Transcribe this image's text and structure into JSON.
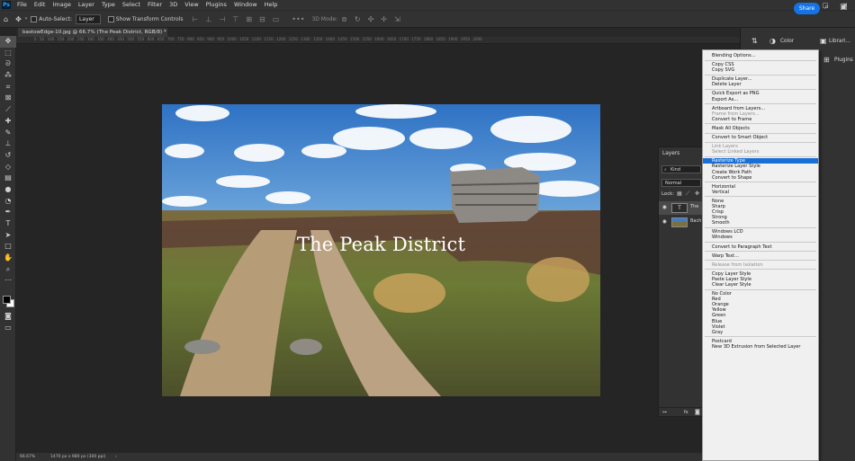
{
  "app": {
    "logo": "Ps"
  },
  "menubar": {
    "items": [
      "File",
      "Edit",
      "Image",
      "Layer",
      "Type",
      "Select",
      "Filter",
      "3D",
      "View",
      "Plugins",
      "Window",
      "Help"
    ]
  },
  "window_controls": {
    "min": "–",
    "max": "□",
    "close": "✕"
  },
  "options": {
    "auto_select_label": "Auto-Select:",
    "auto_select_value": "Layer",
    "transform_label": "Show Transform Controls",
    "mode_label": "3D Mode:",
    "share": "Share"
  },
  "document": {
    "tab": "bastowEdge-10.jpg @ 66.7% (The Peak District, RGB/8) *",
    "tab_close": "×",
    "photo_title": "The Peak District",
    "ruler_marks": "0  50  100  150  200  250  300  350  400  450  500  550  600  650  700  750  800  850  900  950  1000  1050  1100  1150  1200  1250  1300  1350  1400  1450  1500  1550  1600  1650  1700  1750  1800  1850  1900  1950  2000"
  },
  "status": {
    "zoom": "66.67%",
    "size": "1470 px x 980 px (300 ppi)",
    "arrow": "›"
  },
  "panels": {
    "color": "Color",
    "libraries": "Librari...",
    "plugins": "Plugins"
  },
  "layers_panel": {
    "title": "Layers",
    "kind": "Kind",
    "blend": "Normal",
    "lock": "Lock:",
    "layer1": "The",
    "layer2": "Bach",
    "footer": "fx"
  },
  "context_menu": {
    "groups": [
      [
        {
          "label": "Blending Options...",
          "state": "normal"
        }
      ],
      [
        {
          "label": "Copy CSS",
          "state": "normal"
        },
        {
          "label": "Copy SVG",
          "state": "normal"
        }
      ],
      [
        {
          "label": "Duplicate Layer...",
          "state": "normal"
        },
        {
          "label": "Delete Layer",
          "state": "normal"
        }
      ],
      [
        {
          "label": "Quick Export as PNG",
          "state": "normal"
        },
        {
          "label": "Export As...",
          "state": "normal"
        }
      ],
      [
        {
          "label": "Artboard from Layers...",
          "state": "normal"
        },
        {
          "label": "Frame from Layers...",
          "state": "disabled"
        },
        {
          "label": "Convert to Frame",
          "state": "normal"
        }
      ],
      [
        {
          "label": "Mask All Objects",
          "state": "normal"
        }
      ],
      [
        {
          "label": "Convert to Smart Object",
          "state": "normal"
        }
      ],
      [
        {
          "label": "Link Layers",
          "state": "disabled"
        },
        {
          "label": "Select Linked Layers",
          "state": "disabled"
        }
      ],
      [
        {
          "label": "Rasterize Type",
          "state": "highlighted"
        },
        {
          "label": "Rasterize Layer Style",
          "state": "normal"
        },
        {
          "label": "Create Work Path",
          "state": "normal"
        },
        {
          "label": "Convert to Shape",
          "state": "normal"
        }
      ],
      [
        {
          "label": "Horizontal",
          "state": "normal"
        },
        {
          "label": "Vertical",
          "state": "normal"
        }
      ],
      [
        {
          "label": "None",
          "state": "normal"
        },
        {
          "label": "Sharp",
          "state": "normal"
        },
        {
          "label": "Crisp",
          "state": "normal"
        },
        {
          "label": "Strong",
          "state": "normal"
        },
        {
          "label": "Smooth",
          "state": "normal"
        }
      ],
      [
        {
          "label": "Windows LCD",
          "state": "normal"
        },
        {
          "label": "Windows",
          "state": "normal"
        }
      ],
      [
        {
          "label": "Convert to Paragraph Text",
          "state": "normal"
        }
      ],
      [
        {
          "label": "Warp Text...",
          "state": "normal"
        }
      ],
      [
        {
          "label": "Release from Isolation",
          "state": "disabled"
        }
      ],
      [
        {
          "label": "Copy Layer Style",
          "state": "normal"
        },
        {
          "label": "Paste Layer Style",
          "state": "normal"
        },
        {
          "label": "Clear Layer Style",
          "state": "normal"
        }
      ],
      [
        {
          "label": "No Color",
          "state": "normal"
        },
        {
          "label": "Red",
          "state": "normal"
        },
        {
          "label": "Orange",
          "state": "normal"
        },
        {
          "label": "Yellow",
          "state": "normal"
        },
        {
          "label": "Green",
          "state": "normal"
        },
        {
          "label": "Blue",
          "state": "normal"
        },
        {
          "label": "Violet",
          "state": "normal"
        },
        {
          "label": "Gray",
          "state": "normal"
        }
      ],
      [
        {
          "label": "Postcard",
          "state": "normal"
        },
        {
          "label": "New 3D Extrusion from Selected Layer",
          "state": "normal"
        }
      ]
    ]
  },
  "colors": {
    "accent": "#1473e6",
    "highlight": "#1a6fd6",
    "chrome": "#323232",
    "workspace": "#252525"
  }
}
